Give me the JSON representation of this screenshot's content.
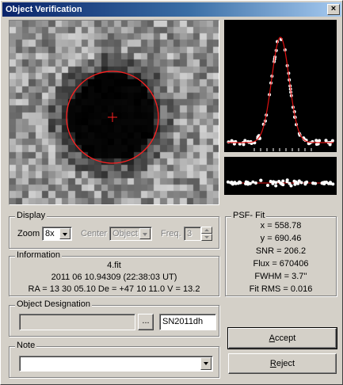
{
  "window": {
    "title": "Object Verification",
    "close_glyph": "×"
  },
  "image": {
    "description_icon": "star-image",
    "colors": {
      "marker": "#ff2020",
      "background_gray": "#9a9a9a"
    }
  },
  "display": {
    "group_label": "Display",
    "zoom_label": "Zoom",
    "zoom_value": "8x",
    "center_label": "Center",
    "center_value": "Object",
    "freq_label": "Freq.",
    "freq_value": "3"
  },
  "information": {
    "group_label": "Information",
    "filename": "4.fit",
    "datetime": "2011 06 10.94309 (22:38:03 UT)",
    "coords": "RA = 13 30 05.10   De = +47 10 11.0   V = 13.2"
  },
  "psf_fit": {
    "group_label": "PSF- Fit",
    "x": "x = 558.78",
    "y": "y = 690.46",
    "snr": "SNR = 206.2",
    "flux": "Flux = 670406",
    "fwhm": "FWHM = 3.7''",
    "fit_rms": "Fit RMS = 0.016"
  },
  "designation": {
    "group_label": "Object Designation",
    "browse_label": "...",
    "name_value": "SN2011dh"
  },
  "note": {
    "group_label": "Note",
    "value": ""
  },
  "buttons": {
    "accept_accel": "A",
    "accept_rest": "ccept",
    "reject_accel": "R",
    "reject_rest": "eject"
  }
}
